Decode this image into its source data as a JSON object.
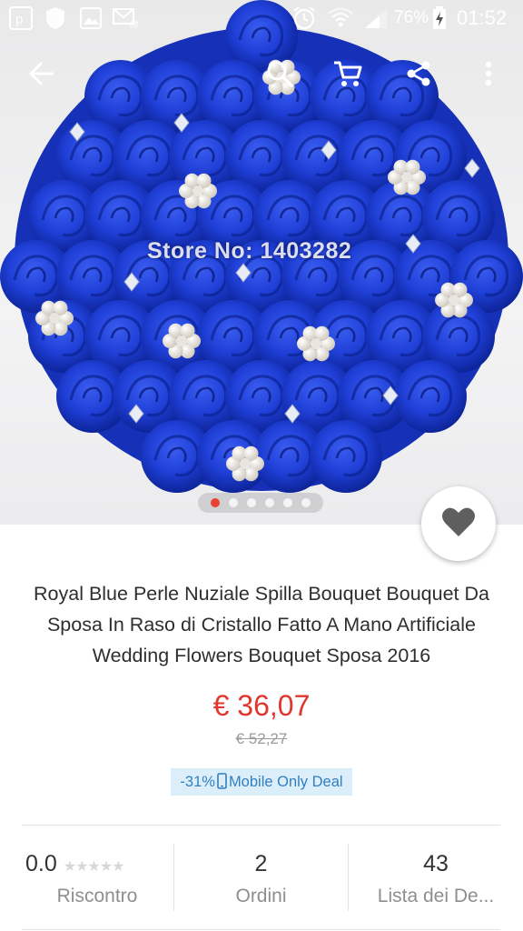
{
  "status_bar": {
    "battery_percent": "76%",
    "time": "01:52",
    "icons": [
      "p-app-icon",
      "shield-icon",
      "gallery-icon",
      "mail-icon",
      "alarm-icon",
      "wifi-icon",
      "signal-icon",
      "battery-charging-icon"
    ]
  },
  "top_bar": {
    "icons": [
      "back-arrow-icon",
      "search-icon",
      "cart-icon",
      "share-icon",
      "more-vert-icon"
    ]
  },
  "hero": {
    "watermark": "Store No: 1403282",
    "pager": {
      "count": 6,
      "active_index": 0
    }
  },
  "product": {
    "title": "Royal Blue Perle Nuziale Spilla Bouquet Bouquet Da Sposa In Raso di Cristallo Fatto A Mano Artificiale Wedding Flowers Bouquet Sposa 2016",
    "price": "€ 36,07",
    "original_price": "€ 52,27",
    "discount": "-31%",
    "deal_label": "Mobile Only Deal"
  },
  "stats": {
    "rating": {
      "value": "0.0",
      "stars": 0,
      "max_stars": 5,
      "label": "Riscontro"
    },
    "orders": {
      "value": "2",
      "label": "Ordini"
    },
    "wishlist": {
      "value": "43",
      "label": "Lista dei De..."
    }
  },
  "colors": {
    "accent": "#e0362d",
    "rose_blue": "#1f3fd6",
    "deal_bg": "#dceefa",
    "deal_text": "#2f7fc1"
  }
}
